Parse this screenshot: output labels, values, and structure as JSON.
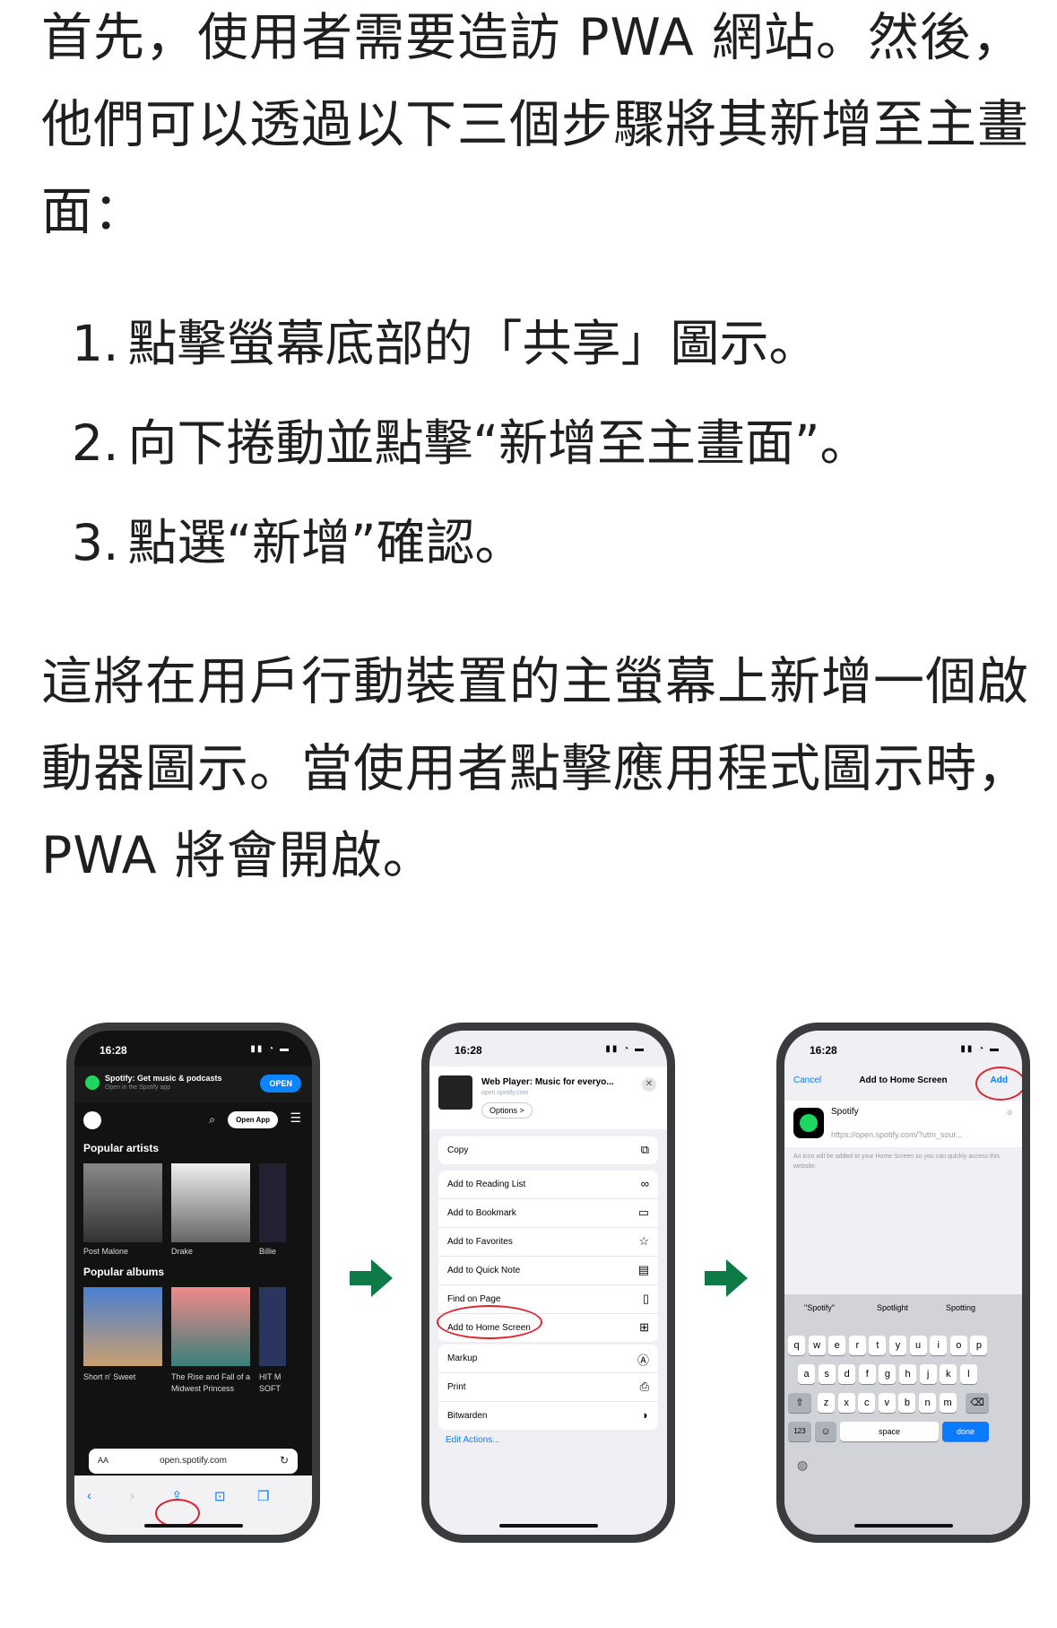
{
  "intro": "首先，使用者需要造訪 PWA 網站。然後，他們可以透過以下三個步驟將其新增至主畫面：",
  "steps": [
    {
      "num": "1.",
      "text": "點擊螢幕底部的「共享」圖示。"
    },
    {
      "num": "2.",
      "text": "向下捲動並點擊“新增至主畫面”。"
    },
    {
      "num": "3.",
      "text": "點選“新增”確認。"
    }
  ],
  "outro": "這將在用戶行動裝置的主螢幕上新增一個啟動器圖示。當使用者點擊應用程式圖示時，PWA 將會開啟。",
  "status_time": "16:28",
  "phone1": {
    "banner_title": "Spotify: Get music & podcasts",
    "banner_sub": "Open in the Spotify app",
    "banner_button": "OPEN",
    "open_app": "Open App",
    "section_artists": "Popular artists",
    "artists": [
      "Post Malone",
      "Drake",
      "Billie"
    ],
    "section_albums": "Popular albums",
    "albums": [
      "Short n' Sweet",
      "The Rise and Fall of a Midwest Princess",
      "HIT M SOFT"
    ],
    "aa": "AA",
    "url": "open.spotify.com"
  },
  "phone2": {
    "sheet_title": "Web Player: Music for everyo...",
    "sheet_url": "open.spotify.com",
    "options": "Options >",
    "copy": "Copy",
    "actions": [
      "Add to Reading List",
      "Add to Bookmark",
      "Add to Favorites",
      "Add to Quick Note",
      "Find on Page",
      "Add to Home Screen"
    ],
    "actions2": [
      "Markup",
      "Print",
      "Bitwarden"
    ],
    "edit": "Edit Actions..."
  },
  "phone3": {
    "cancel": "Cancel",
    "title": "Add to Home Screen",
    "add": "Add",
    "app_name": "Spotify",
    "app_url": "https://open.spotify.com/?utm_sour...",
    "hint": "An icon will be added to your Home Screen so you can quickly access this website.",
    "suggestions": [
      "\"Spotify\"",
      "Spotlight",
      "Spotting"
    ],
    "row1": [
      "q",
      "w",
      "e",
      "r",
      "t",
      "y",
      "u",
      "i",
      "o",
      "p"
    ],
    "row2": [
      "a",
      "s",
      "d",
      "f",
      "g",
      "h",
      "j",
      "k",
      "l"
    ],
    "row3": [
      "z",
      "x",
      "c",
      "v",
      "b",
      "n",
      "m"
    ],
    "k123": "123",
    "space": "space",
    "done": "done"
  },
  "colors": {
    "arrow": "#0e7a45",
    "accent": "#0a7aff",
    "highlight": "#e0232f",
    "spotify": "#1ed760"
  }
}
